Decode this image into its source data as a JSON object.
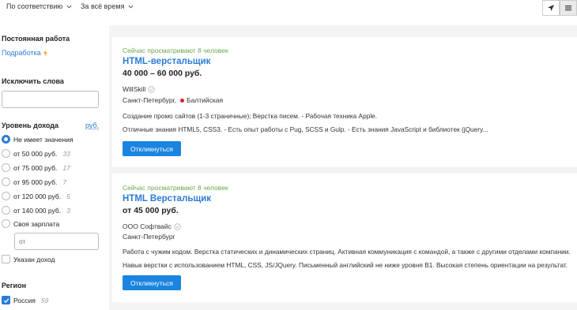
{
  "toolbar": {
    "sort_label": "По соответствию",
    "period_label": "За всё время"
  },
  "sidebar": {
    "permanent_work": "Постоянная работа",
    "side_job": "Подработка",
    "side_job_icon": "lightning-icon",
    "exclude_words": "Исключить слова",
    "income_level": "Уровень дохода",
    "currency": "руб.",
    "income_options": [
      {
        "label": "Не имеет значения",
        "count": "",
        "checked": true
      },
      {
        "label": "от 50 000 руб.",
        "count": "33"
      },
      {
        "label": "от 75 000 руб.",
        "count": "17"
      },
      {
        "label": "от 95 000 руб.",
        "count": "7"
      },
      {
        "label": "от 120 000 руб.",
        "count": "5"
      },
      {
        "label": "от 140 000 руб.",
        "count": "3"
      },
      {
        "label": "Своя зарплата",
        "count": ""
      }
    ],
    "own_salary_placeholder": "от",
    "income_specified": "Указан доход",
    "region": "Регион",
    "region_option": {
      "label": "Россия",
      "count": "59",
      "checked": true
    }
  },
  "vacancies": [
    {
      "viewers": "Сейчас просматривают 8 человек",
      "title": "HTML-верстальщик",
      "salary": "40 000 – 60 000 руб.",
      "company": "WillSkill",
      "city": "Санкт-Петербург,",
      "metro": "Балтийская",
      "responsibilities": "Создание промо сайтов (1-3 страничные); Верстка писем. - Рабочая техника Apple.",
      "requirements": "Отличные знания HTML5, CSS3. - Есть опыт работы с Pug, SCSS и Gulp. - Есть знания JavaScript и библиотек (jQuery...",
      "respond_label": "Откликнуться"
    },
    {
      "viewers": "Сейчас просматривают 8 человек",
      "title": "HTML Верстальщик",
      "salary": "от 45 000 руб.",
      "company": "ООО Софтвайс",
      "city": "Санкт-Петербург",
      "responsibilities": "Работа с чужим кодом. Верстка статических и динамических страниц. Активная коммуникация с командой, а также с другими отделами компании.",
      "requirements": "Навык верстки с использованием HTML, CSS, JS/JQuery. Письменный английский не ниже уровня B1. Высокая степень ориентации на результат.",
      "respond_label": "Откликнуться"
    }
  ],
  "colors": {
    "link": "#2a7bd6",
    "button": "#1a84e0",
    "viewers": "#6aa84f",
    "metro": "#d3202a"
  }
}
